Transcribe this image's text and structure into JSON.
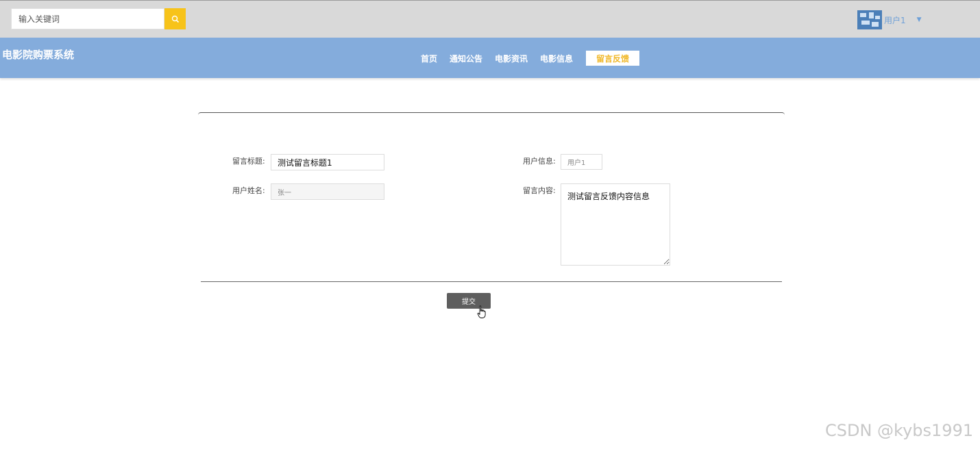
{
  "header": {
    "search": {
      "placeholder": "输入关键词",
      "value": ""
    },
    "search_icon": "search-icon",
    "user": {
      "name": "用户1",
      "caret_icon": "caret-down-icon"
    }
  },
  "navbar": {
    "brand": "电影院购票系统",
    "links": [
      "首页",
      "通知公告",
      "电影资讯",
      "电影信息",
      "留言反馈"
    ],
    "active_index": 4
  },
  "form": {
    "title_label": "留言标题:",
    "title_value": "测试留言标题1",
    "user_info_label": "用户信息:",
    "user_info_value": "用户1",
    "user_name_label": "用户姓名:",
    "user_name_value": "张一",
    "content_label": "留言内容:",
    "content_value": "测试留言反馈内容信息",
    "submit_label": "提交"
  },
  "watermark": "CSDN @kybs1991",
  "colors": {
    "topbar": "#d9d9d9",
    "navbar": "#84acdc",
    "accent": "#f7c31a",
    "active_link_text": "#f0b829",
    "submit": "#5e5e5e"
  }
}
